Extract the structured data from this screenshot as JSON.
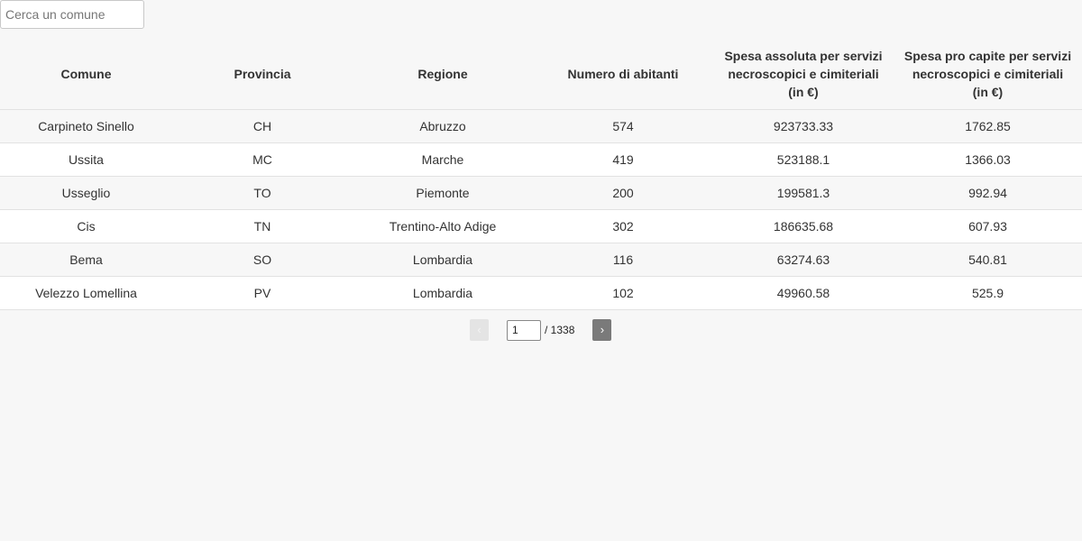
{
  "search": {
    "placeholder": "Cerca un comune",
    "value": ""
  },
  "table": {
    "headers": [
      [
        "Comune"
      ],
      [
        "Provincia"
      ],
      [
        "Regione"
      ],
      [
        "Numero di abitanti"
      ],
      [
        "Spesa assoluta per servizi",
        "necroscopici e cimiteriali",
        "(in €)"
      ],
      [
        "Spesa pro capite per servizi",
        "necroscopici e cimiteriali",
        "(in €)"
      ]
    ],
    "rows": [
      [
        "Carpineto Sinello",
        "CH",
        "Abruzzo",
        "574",
        "923733.33",
        "1762.85"
      ],
      [
        "Ussita",
        "MC",
        "Marche",
        "419",
        "523188.1",
        "1366.03"
      ],
      [
        "Usseglio",
        "TO",
        "Piemonte",
        "200",
        "199581.3",
        "992.94"
      ],
      [
        "Cis",
        "TN",
        "Trentino-Alto Adige",
        "302",
        "186635.68",
        "607.93"
      ],
      [
        "Bema",
        "SO",
        "Lombardia",
        "116",
        "63274.63",
        "540.81"
      ],
      [
        "Velezzo Lomellina",
        "PV",
        "Lombardia",
        "102",
        "49960.58",
        "525.9"
      ]
    ]
  },
  "pager": {
    "prev_label": "‹",
    "next_label": "›",
    "current_page": "1",
    "total_label": "/ 1338"
  }
}
